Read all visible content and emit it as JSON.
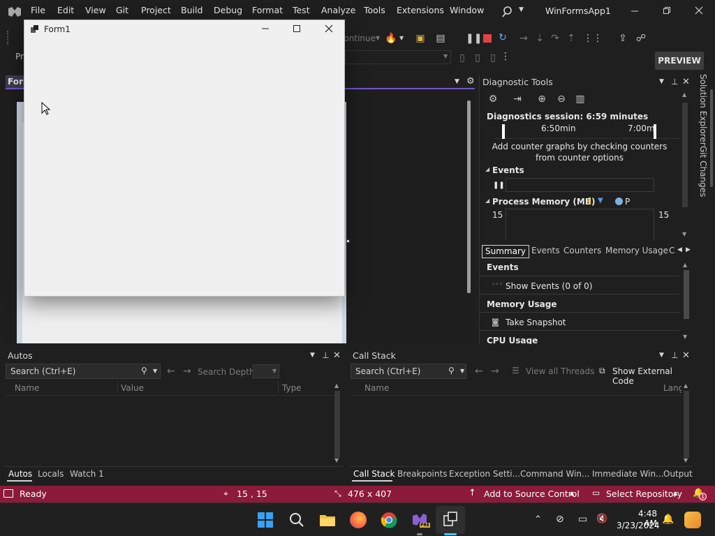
{
  "menubar": {
    "items": [
      "File",
      "Edit",
      "View",
      "Git",
      "Project",
      "Build",
      "Debug",
      "Format",
      "Test",
      "Analyze",
      "Tools",
      "Extensions",
      "Window"
    ],
    "solution_name": "WinFormsApp1"
  },
  "toolbar": {
    "continue_label": "Continue",
    "preview_label": "PREVIEW",
    "left_fragment": "Pr"
  },
  "designer": {
    "tab_fragment": "Form"
  },
  "form_window": {
    "title": "Form1"
  },
  "diagnostics": {
    "title": "Diagnostic Tools",
    "session": "Diagnostics session: 6:59 minutes",
    "time_labels": [
      "6:50min",
      "7:00min"
    ],
    "counter_hint": "Add counter graphs by checking counters from counter options",
    "events_label": "Events",
    "memory_label": "Process Memory (MB)",
    "memory_legend_p": "P",
    "memory_min_left": "15",
    "memory_min_right": "15",
    "tabs": [
      "Summary",
      "Events",
      "Counters",
      "Memory Usage",
      "C"
    ],
    "summary_events_head": "Events",
    "show_events": "Show Events (0 of 0)",
    "memory_usage_head": "Memory Usage",
    "take_snapshot": "Take Snapshot",
    "cpu_usage_head": "CPU Usage"
  },
  "side_tabs": {
    "solution_explorer": "Solution Explorer",
    "git_changes": "Git Changes"
  },
  "autos": {
    "title": "Autos",
    "search_placeholder": "Search (Ctrl+E)",
    "search_depth": "Search Depth:",
    "columns": [
      "Name",
      "Value",
      "Type"
    ],
    "tabs": [
      "Autos",
      "Locals",
      "Watch 1"
    ]
  },
  "callstack": {
    "title": "Call Stack",
    "search_placeholder": "Search (Ctrl+E)",
    "view_threads": "View all Threads",
    "show_external": "Show External Code",
    "columns": [
      "Name",
      "Lang"
    ],
    "tabs": [
      "Call Stack",
      "Breakpoints",
      "Exception Setti...",
      "Command Win...",
      "Immediate Win...",
      "Output"
    ]
  },
  "statusbar": {
    "ready": "Ready",
    "position": "15 , 15",
    "size": "476 x 407",
    "source_control": "Add to Source Control",
    "repository": "Select Repository",
    "notification_count": "1"
  },
  "taskbar": {
    "time": "4:48 AM",
    "date": "3/23/2024",
    "badge": "PRE"
  },
  "colors": {
    "accent": "#8c1a3a",
    "purple": "#6f58c9",
    "vs_purple": "#68217a"
  }
}
